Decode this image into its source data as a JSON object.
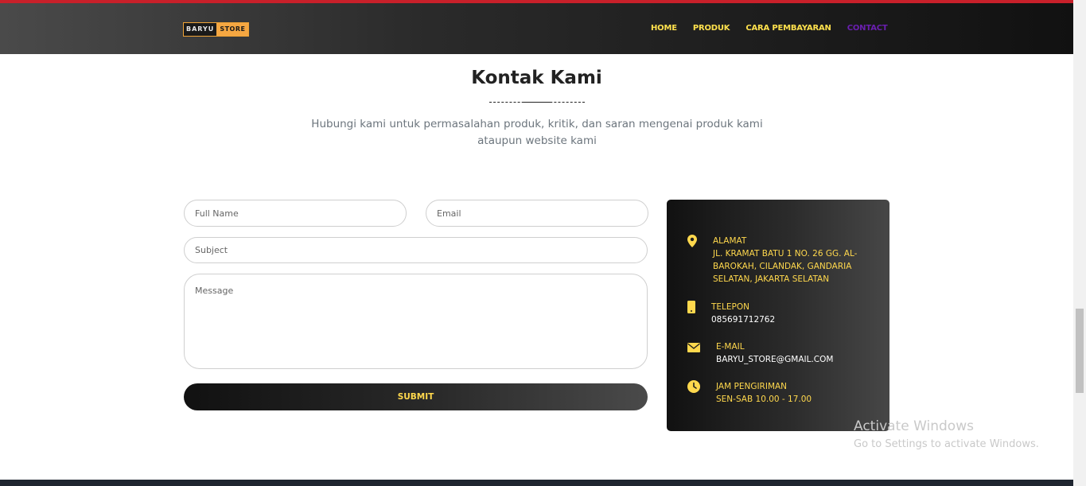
{
  "brand": {
    "logo_part1": "BARYU",
    "logo_part2": "STORE"
  },
  "nav": {
    "items": [
      {
        "label": "HOME"
      },
      {
        "label": "PRODUK"
      },
      {
        "label": "CARA PEMBAYARAN"
      },
      {
        "label": "CONTACT"
      }
    ],
    "active": "CONTACT"
  },
  "section": {
    "title": "Kontak Kami",
    "subtitle_line1": "Hubungi kami untuk permasalahan produk, kritik, dan saran mengenai produk kami",
    "subtitle_line2": "ataupun website kami"
  },
  "form": {
    "name_placeholder": "Full Name",
    "email_placeholder": "Email",
    "subject_placeholder": "Subject",
    "message_placeholder": "Message",
    "submit_label": "SUBMIT"
  },
  "info": {
    "address_label": "ALAMAT",
    "address_lines": [
      "JL. KRAMAT BATU 1 NO. 26 GG. AL-",
      "BAROKAH, CILANDAK, GANDARIA",
      "SELATAN, JAKARTA SELATAN"
    ],
    "phone_label": "TELEPON",
    "phone_value": "085691712762",
    "email_label": "E-MAIL",
    "email_value": "BARYU_STORE@GMAIL.COM",
    "hours_label": "JAM PENGIRIMAN",
    "hours_value": "SEN-SAB 10.00 - 17.00"
  },
  "watermark": {
    "line1": "Activate Windows",
    "line2": "Go to Settings to activate Windows."
  },
  "colors": {
    "accent_yellow": "#ffd84d",
    "active_nav": "#6a1fb0",
    "top_bar": "#c8202a"
  }
}
